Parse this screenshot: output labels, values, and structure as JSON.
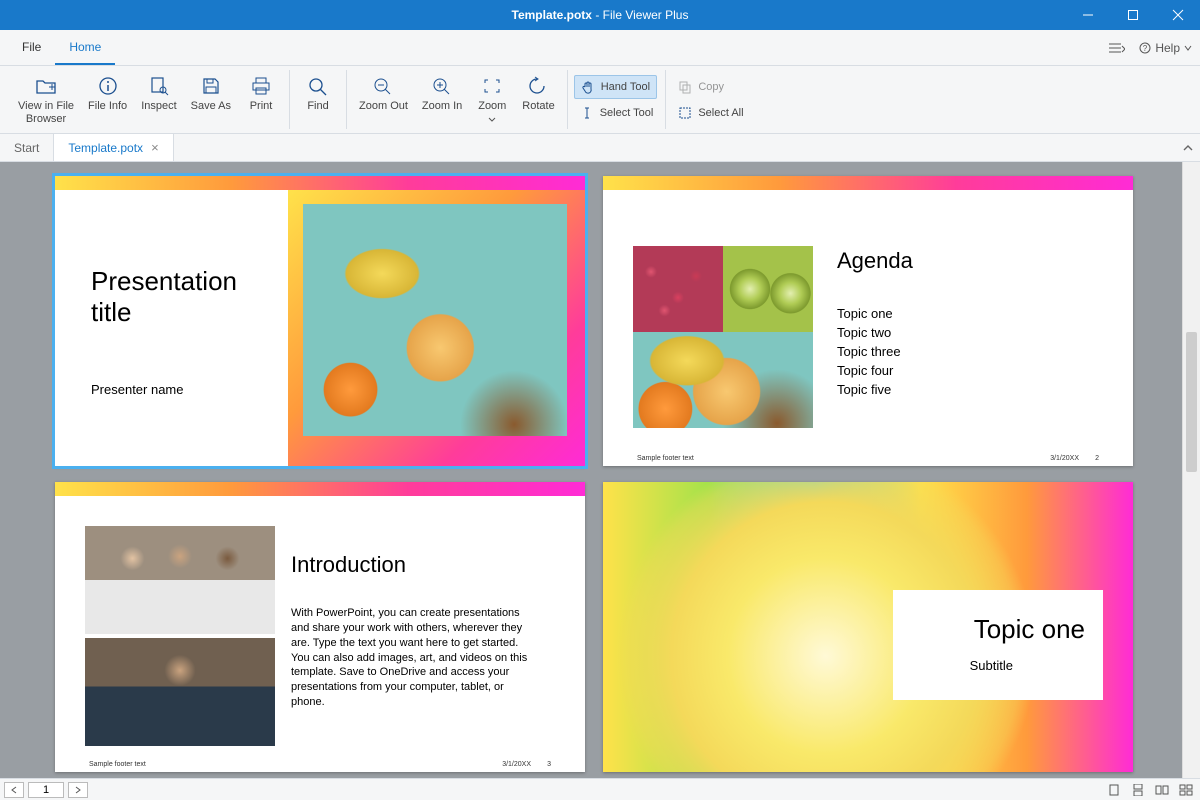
{
  "titlebar": {
    "filename": "Template.potx",
    "appname": "File Viewer Plus"
  },
  "menu": {
    "file": "File",
    "home": "Home",
    "help": "Help"
  },
  "ribbon": {
    "view_browser": "View in File\nBrowser",
    "file_info": "File Info",
    "inspect": "Inspect",
    "save_as": "Save As",
    "print": "Print",
    "find": "Find",
    "zoom_out": "Zoom Out",
    "zoom_in": "Zoom In",
    "zoom": "Zoom",
    "rotate": "Rotate",
    "hand": "Hand Tool",
    "select_tool": "Select Tool",
    "copy": "Copy",
    "select_all": "Select All"
  },
  "tabs": {
    "start": "Start",
    "template": "Template.potx"
  },
  "slides": {
    "s1": {
      "title1": "Presentation",
      "title2": "title",
      "presenter": "Presenter name"
    },
    "s2": {
      "heading": "Agenda",
      "t1": "Topic one",
      "t2": "Topic two",
      "t3": "Topic three",
      "t4": "Topic four",
      "t5": "Topic five",
      "footer": "Sample footer text",
      "date": "3/1/20XX",
      "num": "2"
    },
    "s3": {
      "heading": "Introduction",
      "body": "With PowerPoint, you can create presentations and share your work with others, wherever they are. Type the text you want here to get started. You can also add images, art, and videos on this template. Save to OneDrive and access your presentations from your computer, tablet, or phone.",
      "footer": "Sample footer text",
      "date": "3/1/20XX",
      "num": "3"
    },
    "s4": {
      "heading": "Topic one",
      "sub": "Subtitle"
    }
  },
  "status": {
    "page": "1"
  }
}
